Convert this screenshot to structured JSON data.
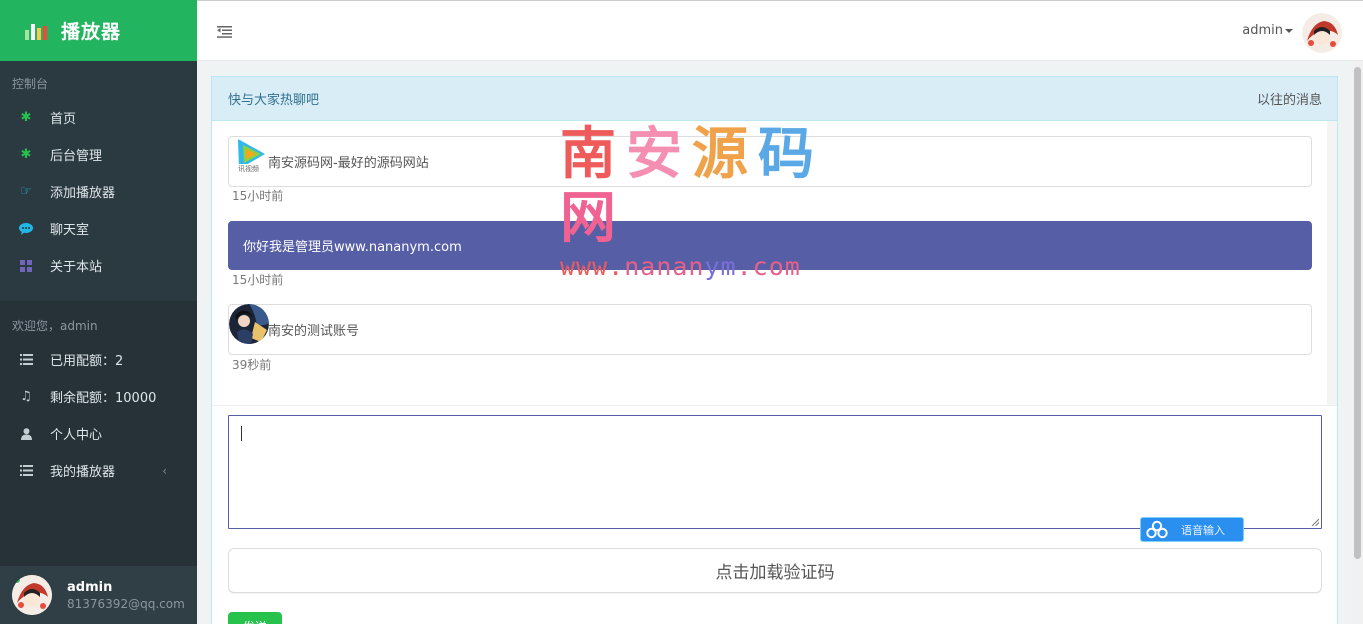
{
  "brand": {
    "title": "播放器",
    "icon": "bar-chart-icon"
  },
  "sidebar": {
    "section_console": "控制台",
    "items": [
      {
        "label": "首页",
        "icon": "asterisk-icon",
        "color": "#27c24c"
      },
      {
        "label": "后台管理",
        "icon": "asterisk-icon",
        "color": "#27c24c"
      },
      {
        "label": "添加播放器",
        "icon": "hand-pointer-icon",
        "color": "#23b7e5"
      },
      {
        "label": "聊天室",
        "icon": "chat-bubble-icon",
        "color": "#23b7e5"
      },
      {
        "label": "关于本站",
        "icon": "grid-icon",
        "color": "#7266ba"
      }
    ],
    "section_welcome": "欢迎您，admin",
    "items2": [
      {
        "label": "已用配额：2",
        "icon": "list-icon"
      },
      {
        "label": "剩余配额：10000",
        "icon": "music-icon"
      },
      {
        "label": "个人中心",
        "icon": "user-icon"
      },
      {
        "label": "我的播放器",
        "icon": "list-icon",
        "arrow": "‹"
      }
    ],
    "user": {
      "name": "admin",
      "email": "81376392@qq.com",
      "status_color": "#27c24c"
    }
  },
  "header": {
    "user_menu": "admin",
    "toggle_icon": "indent-icon"
  },
  "chat": {
    "heading": "快与大家热聊吧",
    "history_link": "以往的消息",
    "messages": [
      {
        "text": "南安源码网-最好的源码网站",
        "time": "15小时前",
        "avatar": "tencent-video-logo"
      },
      {
        "text": "你好我是管理员www.nananym.com",
        "time": "15小时前",
        "style": "admin"
      },
      {
        "text": "南安的测试账号",
        "time": "39秒前",
        "avatar": "anime-avatar"
      }
    ],
    "input": {
      "value": ""
    },
    "baidu_button": "语音输入",
    "captcha_button": "点击加载验证码",
    "send_button": "发送"
  },
  "watermark": {
    "title": "南安源码网",
    "url": "www.nananym.com"
  },
  "colors": {
    "brand": "#23b45f",
    "sidebar": "#263238",
    "admin_message": "#565ea6",
    "panel_heading": "#d9edf7"
  }
}
